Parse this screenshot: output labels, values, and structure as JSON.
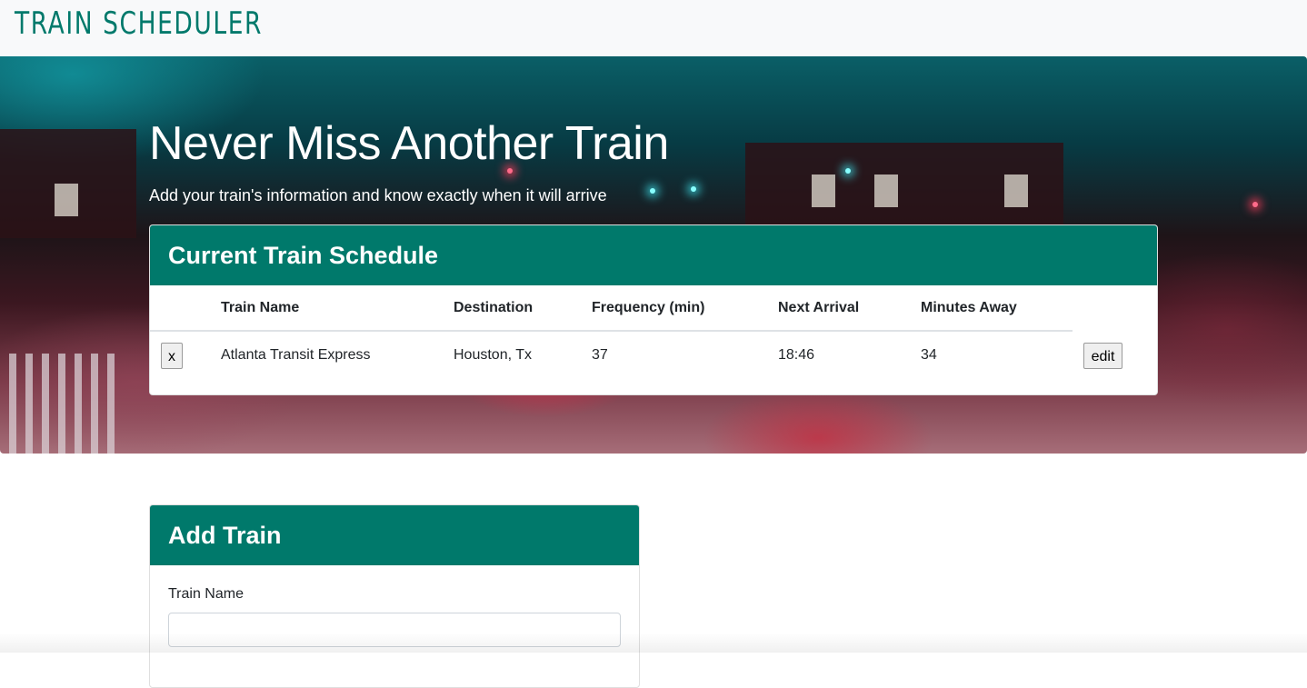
{
  "navbar": {
    "brand": "TRAIN SCHEDULER"
  },
  "hero": {
    "title": "Never Miss Another Train",
    "subtitle": "Add your train's information and know exactly when it will arrive"
  },
  "schedule": {
    "header": "Current Train Schedule",
    "columns": [
      "Train Name",
      "Destination",
      "Frequency (min)",
      "Next Arrival",
      "Minutes Away"
    ],
    "rows": [
      {
        "delete_label": "x",
        "train_name": "Atlanta Transit Express",
        "destination": "Houston, Tx",
        "frequency": "37",
        "next_arrival": "18:46",
        "minutes_away": "34",
        "edit_label": "edit"
      }
    ]
  },
  "add_train": {
    "header": "Add Train",
    "train_name_label": "Train Name",
    "train_name_value": ""
  },
  "colors": {
    "accent": "#00796b",
    "navbar_bg": "#f8f9fa"
  }
}
